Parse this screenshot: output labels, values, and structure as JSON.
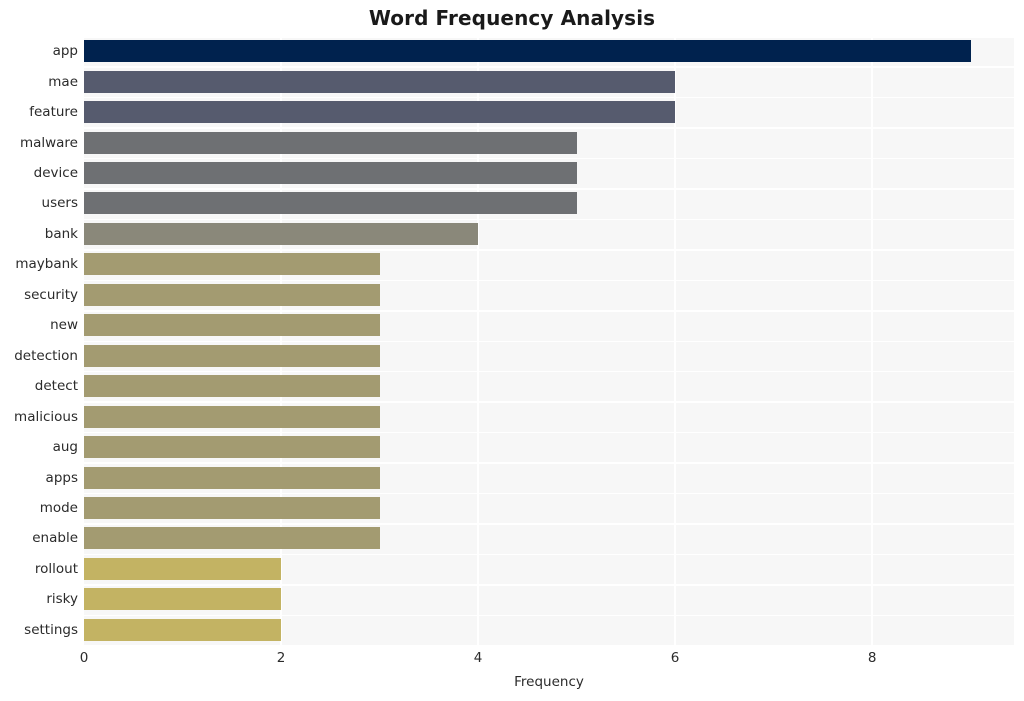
{
  "chart_data": {
    "type": "bar",
    "orientation": "horizontal",
    "title": "Word Frequency Analysis",
    "xlabel": "Frequency",
    "ylabel": "",
    "categories": [
      "app",
      "mae",
      "feature",
      "malware",
      "device",
      "users",
      "bank",
      "maybank",
      "security",
      "new",
      "detection",
      "detect",
      "malicious",
      "aug",
      "apps",
      "mode",
      "enable",
      "rollout",
      "risky",
      "settings"
    ],
    "values": [
      9,
      6,
      6,
      5,
      5,
      5,
      4,
      3,
      3,
      3,
      3,
      3,
      3,
      3,
      3,
      3,
      3,
      2,
      2,
      2
    ],
    "bar_colors": [
      "#00224e",
      "#565b6e",
      "#565b6e",
      "#6e7073",
      "#6e7073",
      "#6e7073",
      "#8a887a",
      "#a39b71",
      "#a39b71",
      "#a39b71",
      "#a39b71",
      "#a39b71",
      "#a39b71",
      "#a39b71",
      "#a39b71",
      "#a39b71",
      "#a39b71",
      "#c3b363",
      "#c3b363",
      "#c3b363"
    ],
    "xlim": [
      0,
      9.44
    ],
    "xticks": [
      0,
      2,
      4,
      6,
      8
    ],
    "xtick_labels": [
      "0",
      "2",
      "4",
      "6",
      "8"
    ],
    "grid": true,
    "grid_color": "#ffffff",
    "plot_background": "#f7f7f7",
    "figure_background": "#ffffff",
    "legend": null,
    "title_color": "#1a1a1a",
    "tick_color": "#2b2b2b"
  }
}
